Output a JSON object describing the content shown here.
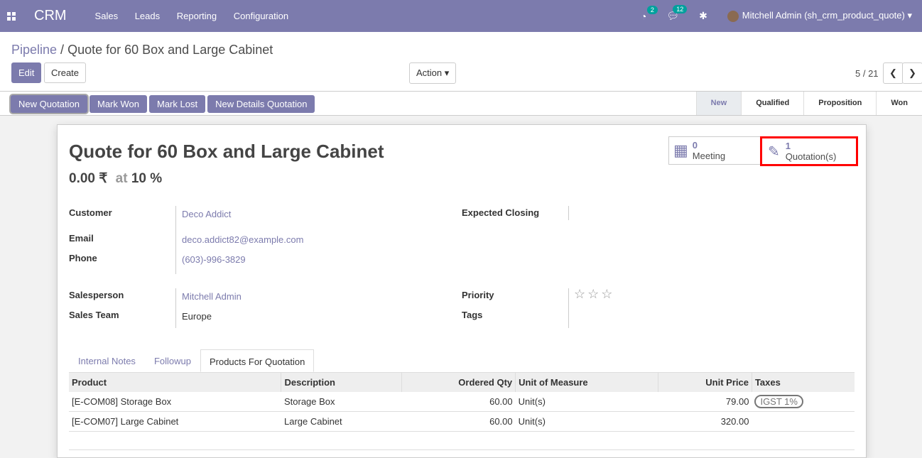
{
  "app": "CRM",
  "menu": [
    "Sales",
    "Leads",
    "Reporting",
    "Configuration"
  ],
  "activity_count": "2",
  "message_count": "12",
  "user": "Mitchell Admin (sh_crm_product_quote)",
  "breadcrumb": {
    "parent": "Pipeline",
    "current": "Quote for 60 Box and Large Cabinet"
  },
  "buttons": {
    "edit": "Edit",
    "create": "Create",
    "action": "Action"
  },
  "pager": "5 / 21",
  "header_buttons": [
    "New Quotation",
    "Mark Won",
    "Mark Lost",
    "New Details Quotation"
  ],
  "stages": [
    "New",
    "Qualified",
    "Proposition",
    "Won"
  ],
  "smart": {
    "meeting_count": "0",
    "meeting_label": "Meeting",
    "quote_count": "1",
    "quote_label": "Quotation(s)"
  },
  "title": "Quote for 60 Box and Large Cabinet",
  "revenue": "0.00 ₹",
  "at": "at",
  "prob": "10 %",
  "fields": {
    "customer_l": "Customer",
    "customer": "Deco Addict",
    "email_l": "Email",
    "email": "deco.addict82@example.com",
    "phone_l": "Phone",
    "phone": "(603)-996-3829",
    "closing_l": "Expected Closing",
    "salesperson_l": "Salesperson",
    "salesperson": "Mitchell Admin",
    "team_l": "Sales Team",
    "team": "Europe",
    "priority_l": "Priority",
    "tags_l": "Tags"
  },
  "tabs": [
    "Internal Notes",
    "Followup",
    "Products For Quotation"
  ],
  "table": {
    "headers": [
      "Product",
      "Description",
      "Ordered Qty",
      "Unit of Measure",
      "Unit Price",
      "Taxes"
    ],
    "rows": [
      [
        "[E-COM08] Storage Box",
        "Storage Box",
        "60.00",
        "Unit(s)",
        "79.00",
        "IGST 1%"
      ],
      [
        "[E-COM07] Large Cabinet",
        "Large Cabinet",
        "60.00",
        "Unit(s)",
        "320.00",
        ""
      ]
    ]
  }
}
